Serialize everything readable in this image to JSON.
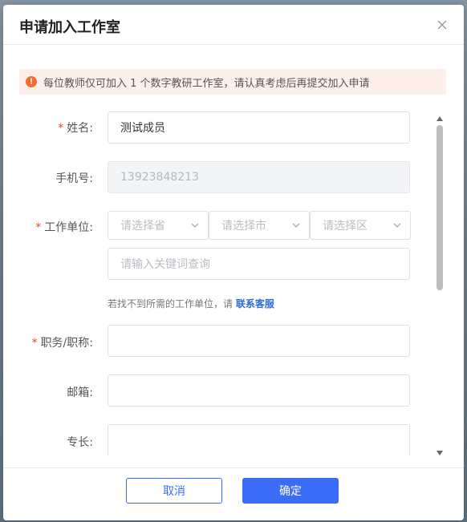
{
  "dialog": {
    "title": "申请加入工作室"
  },
  "alert": {
    "icon": "exclamation-icon",
    "icon_glyph": "!",
    "text": "每位教师仅可加入 1 个数字教研工作室，请认真考虑后再提交加入申请",
    "color": "#f46b2f"
  },
  "form": {
    "name": {
      "required": "*",
      "label": "姓名:",
      "value": "测试成员"
    },
    "phone": {
      "label": "手机号:",
      "value": "13923848213"
    },
    "workplace": {
      "required": "*",
      "label": "工作单位:",
      "province_placeholder": "请选择省",
      "city_placeholder": "请选择市",
      "district_placeholder": "请选择区",
      "search_placeholder": "请输入关键词查询",
      "hint_text": "若找不到所需的工作单位，请",
      "hint_link": "联系客服"
    },
    "position": {
      "required": "*",
      "label": "职务/职称:",
      "value": ""
    },
    "email": {
      "label": "邮箱:",
      "value": ""
    },
    "specialty": {
      "label": "专长:",
      "value": ""
    }
  },
  "footer": {
    "cancel_label": "取消",
    "ok_label": "确定"
  },
  "colors": {
    "primary": "#3a6cf6",
    "required": "#e8442e",
    "link": "#2c6bd6",
    "alert_bg": "#fdf0ea"
  }
}
